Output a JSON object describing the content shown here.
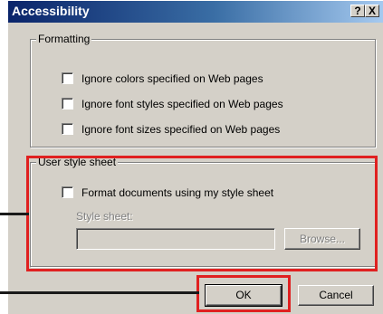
{
  "window": {
    "title": "Accessibility",
    "help_glyph": "?",
    "close_glyph": "X"
  },
  "formatting": {
    "legend": "Formatting",
    "options": [
      {
        "label": "Ignore colors specified on Web pages",
        "checked": false
      },
      {
        "label": "Ignore font styles specified on Web pages",
        "checked": false
      },
      {
        "label": "Ignore font sizes specified on Web pages",
        "checked": false
      }
    ]
  },
  "user_style_sheet": {
    "legend": "User style sheet",
    "format_label": "Format documents using my style sheet",
    "format_checked": false,
    "style_sheet_label": "Style sheet:",
    "style_sheet_value": "",
    "browse_label": "Browse..."
  },
  "buttons": {
    "ok": "OK",
    "cancel": "Cancel"
  },
  "colors": {
    "highlight": "#e02020",
    "face": "#d4d0c8",
    "title_start": "#0a246a",
    "title_end": "#a6caf0"
  }
}
